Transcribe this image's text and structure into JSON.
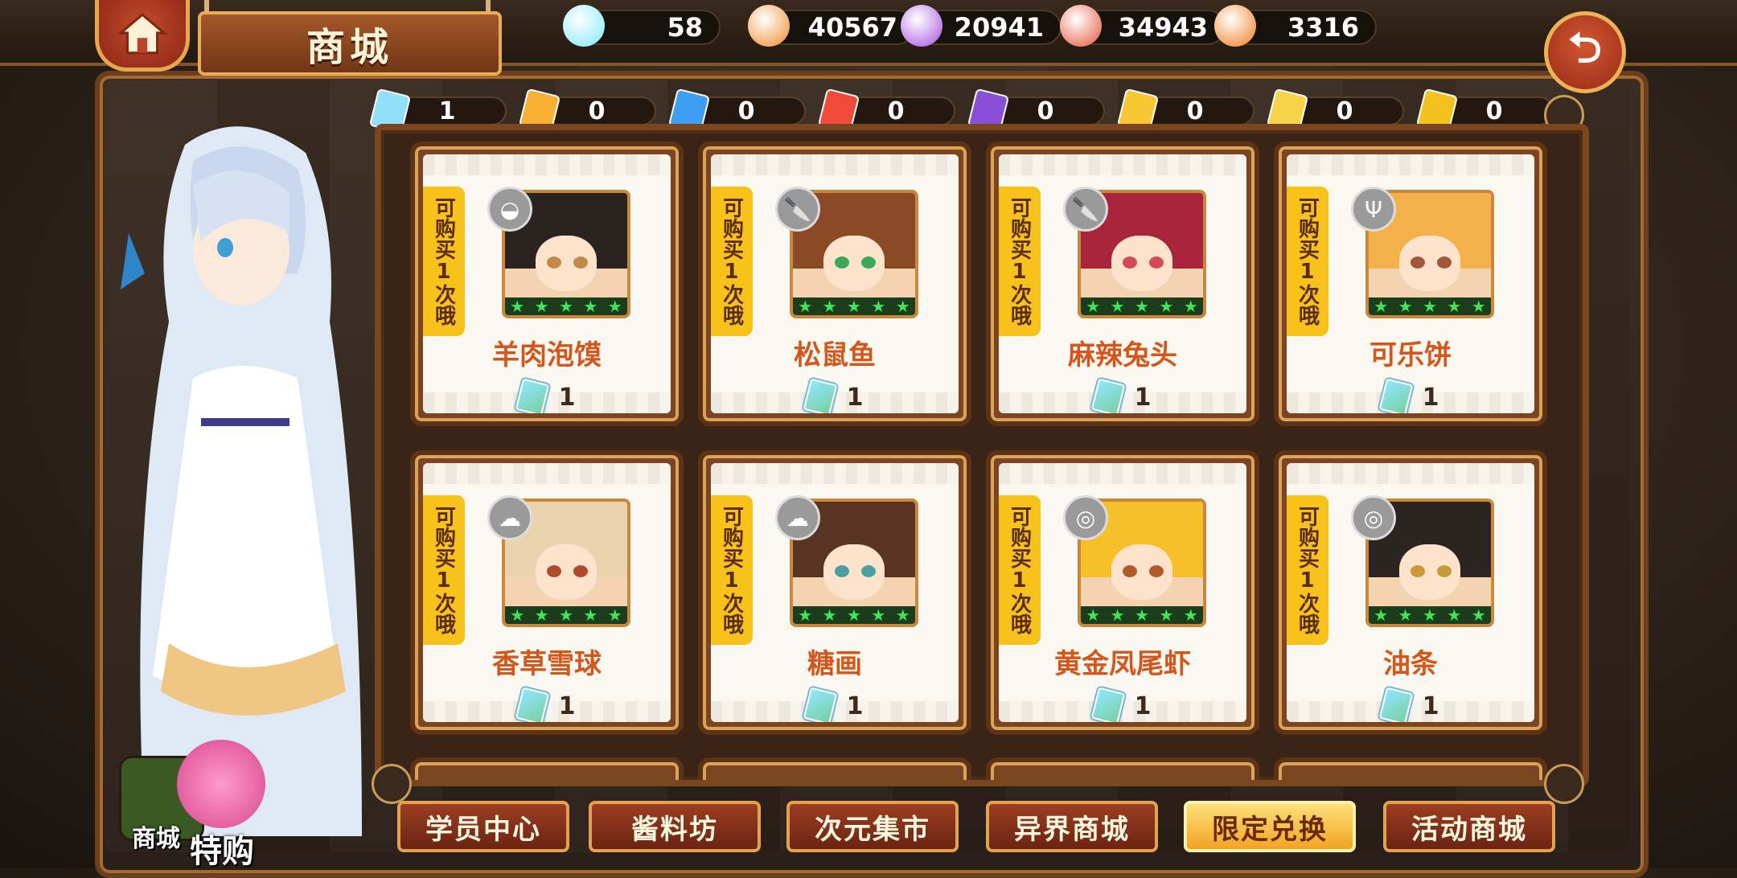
{
  "header": {
    "title": "商城",
    "currencies": [
      {
        "icon": "rainbow-gem-icon",
        "value": "58",
        "color": "#7ee8ff"
      },
      {
        "icon": "potion-flask-icon",
        "value": "40567",
        "color": "#f28a2a"
      },
      {
        "icon": "purple-crystal-icon",
        "value": "20941",
        "color": "#a64fe0"
      },
      {
        "icon": "meat-food-icon",
        "value": "34943",
        "color": "#e4543a"
      },
      {
        "icon": "orange-pot-icon",
        "value": "3316",
        "color": "#ef7b1c"
      }
    ]
  },
  "tickets": [
    {
      "value": "1",
      "color": "#8fe0f8",
      "label": ""
    },
    {
      "value": "0",
      "color": "#f7b034",
      "label": ""
    },
    {
      "value": "0",
      "color": "#3d9df2",
      "label": ""
    },
    {
      "value": "0",
      "color": "#f04a3a",
      "label": ""
    },
    {
      "value": "0",
      "color": "#8a4fd8",
      "label": ""
    },
    {
      "value": "0",
      "color": "#f7c734",
      "label": ""
    },
    {
      "value": "0",
      "color": "#f7d34a",
      "label": ""
    },
    {
      "value": "0",
      "color": "#f4c21e",
      "label": ""
    }
  ],
  "items": [
    {
      "name": "羊肉泡馍",
      "limit": "可购买1次哦",
      "price": "1",
      "badge": "bowl-icon",
      "hair": "#2a2320",
      "eye": "#c08a4a"
    },
    {
      "name": "松鼠鱼",
      "limit": "可购买1次哦",
      "price": "1",
      "badge": "knife-icon",
      "hair": "#8a4a24",
      "eye": "#3aa85a"
    },
    {
      "name": "麻辣兔头",
      "limit": "可购买1次哦",
      "price": "1",
      "badge": "knife-icon",
      "hair": "#a8243a",
      "eye": "#d44a5a"
    },
    {
      "name": "可乐饼",
      "limit": "可购买1次哦",
      "price": "1",
      "badge": "fork-icon",
      "hair": "#f4b04a",
      "eye": "#a0583a"
    },
    {
      "name": "香草雪球",
      "limit": "可购买1次哦",
      "price": "1",
      "badge": "muffin-icon",
      "hair": "#e9d4ae",
      "eye": "#b04a2a"
    },
    {
      "name": "糖画",
      "limit": "可购买1次哦",
      "price": "1",
      "badge": "muffin-icon",
      "hair": "#5a3422",
      "eye": "#4aa0a0"
    },
    {
      "name": "黄金凤尾虾",
      "limit": "可购买1次哦",
      "price": "1",
      "badge": "plate-icon",
      "hair": "#f5c02a",
      "eye": "#b05a2a"
    },
    {
      "name": "油条",
      "limit": "可购买1次哦",
      "price": "1",
      "badge": "plate-icon",
      "hair": "#2c2420",
      "eye": "#c89a3a"
    }
  ],
  "tabs": [
    {
      "label": "学员中心",
      "active": false
    },
    {
      "label": "酱料坊",
      "active": false
    },
    {
      "label": "次元集市",
      "active": false
    },
    {
      "label": "异界商城",
      "active": false
    },
    {
      "label": "限定兑换",
      "active": true
    },
    {
      "label": "活动商城",
      "active": false
    }
  ],
  "side_buttons": {
    "shop_label": "商城",
    "special_label": "特购"
  }
}
